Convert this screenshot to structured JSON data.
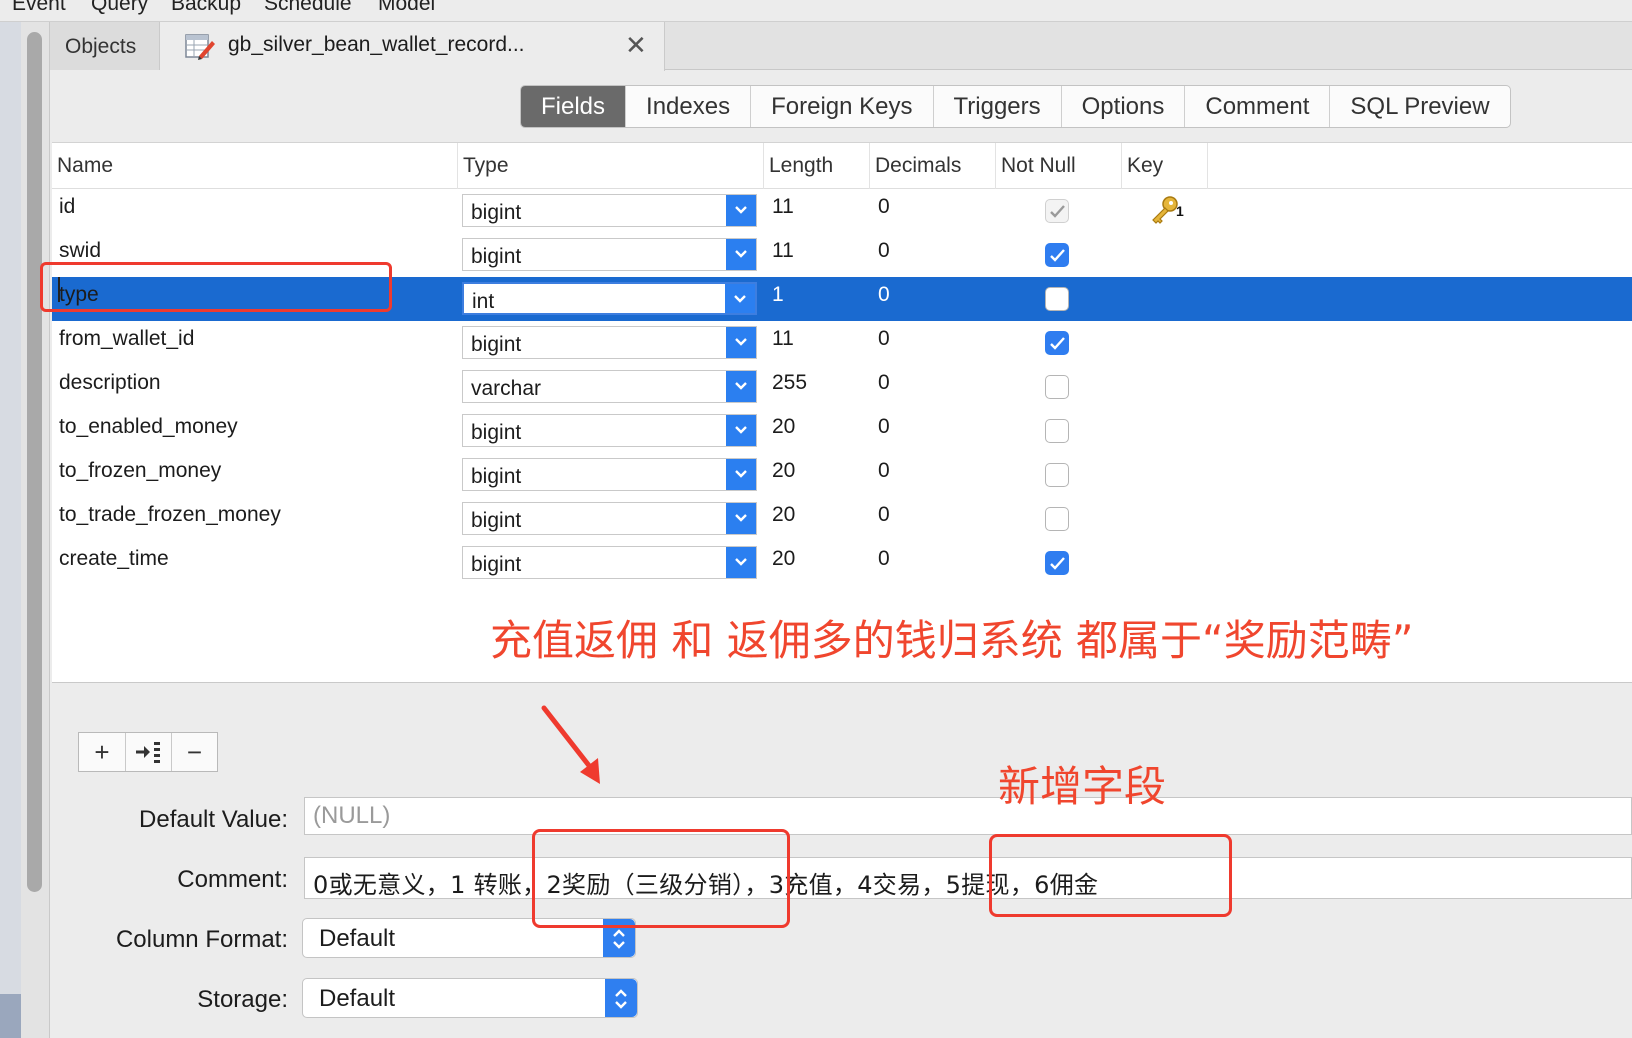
{
  "menubar": {
    "items": [
      "Event",
      "Query",
      "Backup",
      "Schedule",
      "Model"
    ]
  },
  "tabs": {
    "objects_label": "Objects",
    "table_tab_title": "gb_silver_bean_wallet_record...",
    "close_glyph": "✕"
  },
  "segments": [
    "Fields",
    "Indexes",
    "Foreign Keys",
    "Triggers",
    "Options",
    "Comment",
    "SQL Preview"
  ],
  "active_segment": "Fields",
  "columns": {
    "name": "Name",
    "type": "Type",
    "length": "Length",
    "decimals": "Decimals",
    "not_null": "Not Null",
    "key": "Key"
  },
  "fields": [
    {
      "name": "id",
      "type": "bigint",
      "length": "11",
      "decimals": "0",
      "not_null": true,
      "not_null_disabled": true,
      "key": "1",
      "selected": false
    },
    {
      "name": "swid",
      "type": "bigint",
      "length": "11",
      "decimals": "0",
      "not_null": true,
      "selected": false
    },
    {
      "name": "type",
      "type": "int",
      "length": "1",
      "decimals": "0",
      "not_null": false,
      "selected": true
    },
    {
      "name": "from_wallet_id",
      "type": "bigint",
      "length": "11",
      "decimals": "0",
      "not_null": true,
      "selected": false
    },
    {
      "name": "description",
      "type": "varchar",
      "length": "255",
      "decimals": "0",
      "not_null": false,
      "selected": false
    },
    {
      "name": "to_enabled_money",
      "type": "bigint",
      "length": "20",
      "decimals": "0",
      "not_null": false,
      "selected": false
    },
    {
      "name": "to_frozen_money",
      "type": "bigint",
      "length": "20",
      "decimals": "0",
      "not_null": false,
      "selected": false
    },
    {
      "name": "to_trade_frozen_money",
      "type": "bigint",
      "length": "20",
      "decimals": "0",
      "not_null": false,
      "selected": false
    },
    {
      "name": "create_time",
      "type": "bigint",
      "length": "20",
      "decimals": "0",
      "not_null": true,
      "selected": false
    }
  ],
  "annotations": {
    "main": "充值返佣 和 返佣多的钱归系统 都属于“奖励范畴”",
    "new_field": "新增字段"
  },
  "toolbar": {
    "add": "+",
    "remove": "−"
  },
  "properties": {
    "default_value_label": "Default Value:",
    "default_value_placeholder": "(NULL)",
    "comment_label": "Comment:",
    "comment_value": "0或无意义，1 转账，2奖励（三级分销），3充值，4交易，5提现，6佣金",
    "column_format_label": "Column Format:",
    "column_format_value": "Default",
    "storage_label": "Storage:",
    "storage_value": "Default"
  },
  "icons": {
    "table_tab": "table-edit-icon",
    "primary_key": "key-icon",
    "dropdown": "chevron-down-icon",
    "popup": "up-down-chevron-icon",
    "arrow": "red-arrow-icon"
  },
  "colors": {
    "selection": "#1a6ad0",
    "accent_blue": "#2f7ff0",
    "annotation_red": "#f0462e"
  }
}
